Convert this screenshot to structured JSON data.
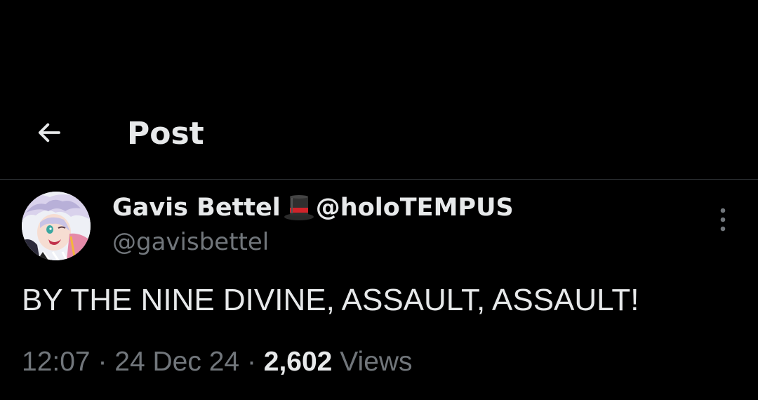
{
  "header": {
    "back_icon": "arrow-left-icon",
    "title": "Post"
  },
  "tweet": {
    "author": {
      "name": "Gavis Bettel",
      "name_emoji": "top-hat-icon",
      "name_suffix": "@holoTEMPUS",
      "handle": "@gavisbettel",
      "avatar": "avatar-illustration"
    },
    "more_icon": "more-vertical-icon",
    "text": "BY THE NINE DIVINE, ASSAULT, ASSAULT!",
    "time": "12:07",
    "separator": "·",
    "date": "24 Dec 24",
    "views_count": "2,602",
    "views_label": "Views"
  },
  "colors": {
    "background": "#000000",
    "primary_text": "#e7e9ea",
    "secondary_text": "#71767b",
    "divider": "#2f3336"
  }
}
